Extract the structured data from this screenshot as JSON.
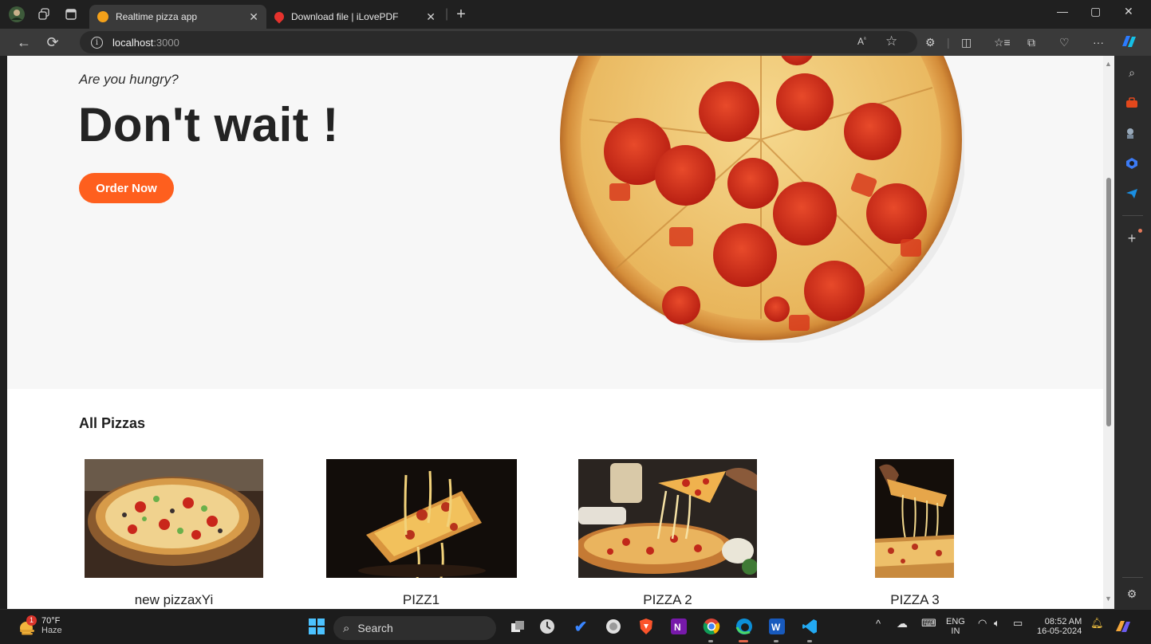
{
  "browser": {
    "tabs": [
      {
        "title": "Realtime pizza app",
        "active": true
      },
      {
        "title": "Download file | iLovePDF",
        "active": false
      }
    ],
    "address": {
      "host": "localhost",
      "port": ":3000"
    },
    "read_aloud_label": "Aᵃ"
  },
  "hero": {
    "tagline": "Are you hungry?",
    "headline": "Don't wait !",
    "cta_label": "Order Now"
  },
  "menu": {
    "section_title": "All Pizzas",
    "items": [
      {
        "name": "new pizzaxYi"
      },
      {
        "name": "PIZZ1"
      },
      {
        "name": "PIZZA 2"
      },
      {
        "name": "PIZZA 3"
      }
    ]
  },
  "taskbar": {
    "weather": {
      "temp": "70°F",
      "condition": "Haze",
      "badge": "1"
    },
    "search_label": "Search",
    "language": {
      "lang": "ENG",
      "region": "IN"
    },
    "clock": {
      "time": "08:52 AM",
      "date": "16-05-2024"
    }
  },
  "colors": {
    "accent": "#fe5f1e",
    "hero_bg": "#f7f7f7",
    "chrome": "#202020"
  }
}
